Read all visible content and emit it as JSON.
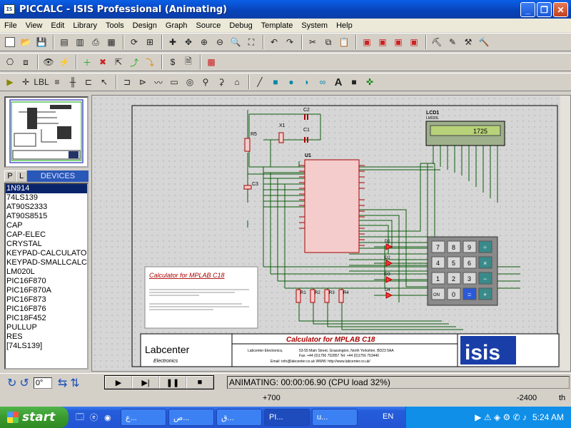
{
  "window": {
    "title": "PICCALC - ISIS Professional (Animating)",
    "app_icon": "isis-icon"
  },
  "menu": [
    "File",
    "View",
    "Edit",
    "Library",
    "Tools",
    "Design",
    "Graph",
    "Source",
    "Debug",
    "Template",
    "System",
    "Help"
  ],
  "devices_tab": {
    "p": "P",
    "l": "L",
    "header": "DEVICES"
  },
  "devices": [
    "1N914",
    "74LS139",
    "AT90S2333",
    "AT90S8515",
    "CAP",
    "CAP-ELEC",
    "CRYSTAL",
    "KEYPAD-CALCULATOR",
    "KEYPAD-SMALLCALC",
    "LM020L",
    "PIC16F870",
    "PIC16F870A",
    "PIC16F873",
    "PIC16F876",
    "PIC18F452",
    "PULLUP",
    "RES",
    "[74LS139]"
  ],
  "selected_device": "1N914",
  "schematic": {
    "lcd_label": "LCD1",
    "lcd_sub": "LM020L",
    "lcd_value": "1725",
    "u1_label": "U1",
    "c1": "C1",
    "c2": "C2",
    "c3": "C3",
    "x1": "X1",
    "r5": "R5",
    "r1": "R1",
    "r2": "R2",
    "r3": "R3",
    "r4": "R4",
    "d1": "D1",
    "d2": "D2",
    "d3": "D3",
    "d4": "D4",
    "keys": [
      "7",
      "8",
      "9",
      "÷",
      "4",
      "5",
      "6",
      "×",
      "1",
      "2",
      "3",
      "−",
      "ON",
      "0",
      "=",
      "+"
    ],
    "note_title": "Calculator for MPLAB C18",
    "title_block": {
      "title": "Calculator for MPLAB C18",
      "company": "Labcenter Electronics,",
      "address": "53-55 Main Street,   Grassington,   North Yorkshire.   BD23 5AA",
      "phone": "Fax: +44 (0)1756 752857    Tel: +44 (0)1756 753440",
      "email": "Email:  info@labcenter.co.uk      WWW:  http://www.labcenter.co.uk/",
      "logo": "Labcenter",
      "logo_sub": "Electronics",
      "brand": "isis"
    }
  },
  "controls": {
    "angle": "0°"
  },
  "status": "ANIMATING: 00:00:06.90 (CPU load 32%)",
  "coords": {
    "x": "+700",
    "y": "-2400",
    "unit": "th"
  },
  "taskbar": {
    "start": "start",
    "tasks": [
      "ع...",
      "ص...",
      "ق...",
      "PI...",
      "u..."
    ],
    "lang": "EN",
    "clock": "5:24 AM"
  }
}
